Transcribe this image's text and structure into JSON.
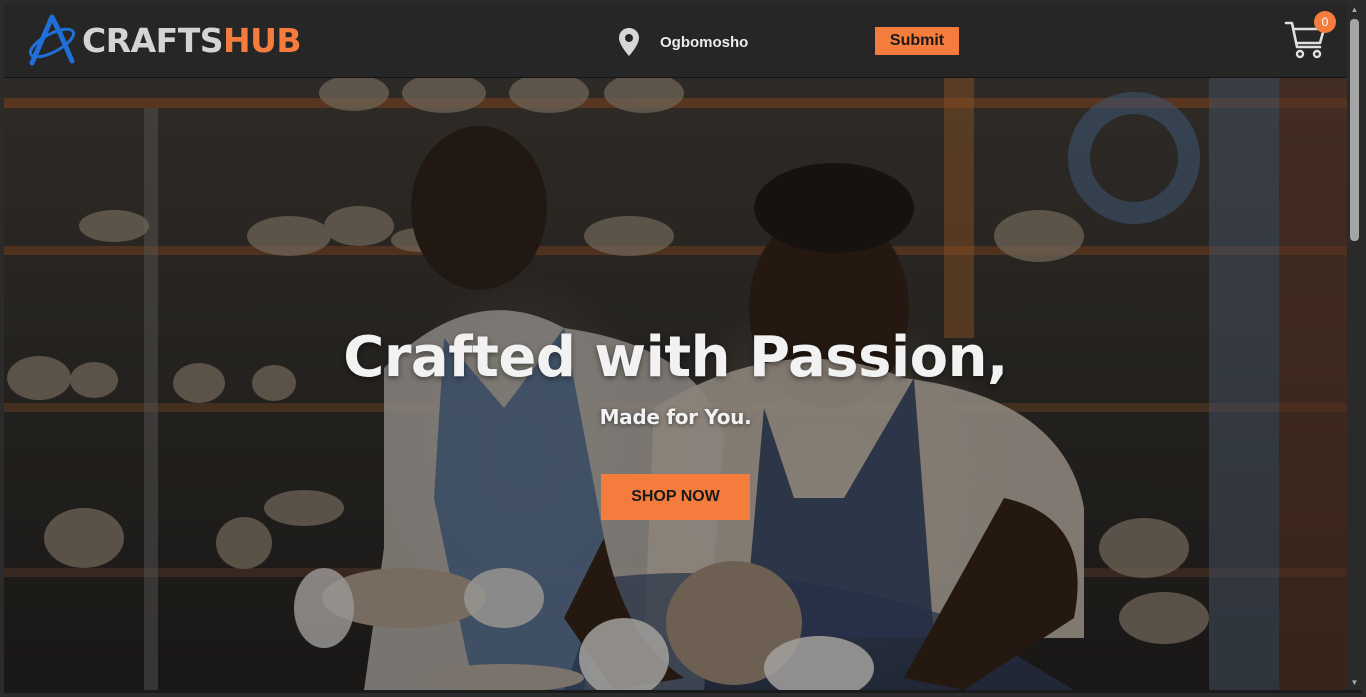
{
  "brand": {
    "name_part1": "CRAFTS",
    "name_part2": "HUB"
  },
  "header": {
    "location": "Ogbomosho",
    "submit_label": "Submit",
    "cart_count": "0"
  },
  "hero": {
    "title": "Crafted with Passion,",
    "subtitle": "Made for You.",
    "cta_label": "SHOP NOW"
  },
  "icons": {
    "logo": "craftshub-logo-icon",
    "location": "map-pin-icon",
    "cart": "shopping-cart-icon"
  },
  "colors": {
    "accent": "#f47c3c",
    "navbar_bg": "#262626",
    "logo_blue": "#1f6fd6"
  }
}
